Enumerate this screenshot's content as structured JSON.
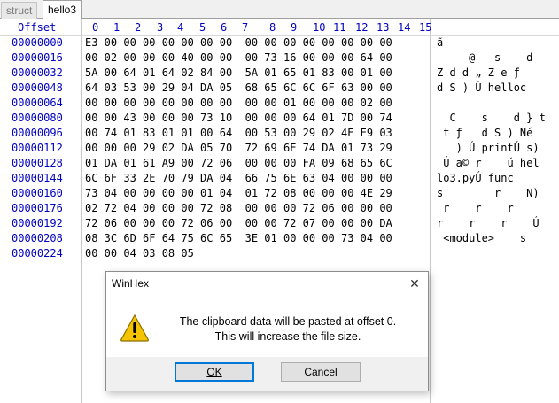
{
  "tabs": [
    {
      "label": "struct",
      "active": false
    },
    {
      "label": "hello3",
      "active": true
    }
  ],
  "header": {
    "offset_label": "Offset",
    "columns": [
      "0",
      "1",
      "2",
      "3",
      "4",
      "5",
      "6",
      "7",
      "8",
      "9",
      "10",
      "11",
      "12",
      "13",
      "14",
      "15"
    ]
  },
  "rows": [
    {
      "offset": "00000000",
      "hex": "E3 00 00 00 00 00 00 00  00 00 00 00 00 00 00 00",
      "text": "ã"
    },
    {
      "offset": "00000016",
      "hex": "00 02 00 00 00 40 00 00  00 73 16 00 00 00 64 00",
      "text": "     @   s    d"
    },
    {
      "offset": "00000032",
      "hex": "5A 00 64 01 64 02 84 00  5A 01 65 01 83 00 01 00",
      "text": "Z d d „ Z e ƒ"
    },
    {
      "offset": "00000048",
      "hex": "64 03 53 00 29 04 DA 05  68 65 6C 6C 6F 63 00 00",
      "text": "d S ) Ú helloc"
    },
    {
      "offset": "00000064",
      "hex": "00 00 00 00 00 00 00 00  00 00 01 00 00 00 02 00",
      "text": ""
    },
    {
      "offset": "00000080",
      "hex": "00 00 43 00 00 00 73 10  00 00 00 64 01 7D 00 74",
      "text": "  C    s    d } t"
    },
    {
      "offset": "00000096",
      "hex": "00 74 01 83 01 01 00 64  00 53 00 29 02 4E E9 03",
      "text": " t ƒ   d S ) Né"
    },
    {
      "offset": "00000112",
      "hex": "00 00 00 29 02 DA 05 70  72 69 6E 74 DA 01 73 29",
      "text": "   ) Ú printÚ s)"
    },
    {
      "offset": "00000128",
      "hex": "01 DA 01 61 A9 00 72 06  00 00 00 FA 09 68 65 6C",
      "text": " Ú a© r    ú hel"
    },
    {
      "offset": "00000144",
      "hex": "6C 6F 33 2E 70 79 DA 04  66 75 6E 63 04 00 00 00",
      "text": "lo3.pyÚ func"
    },
    {
      "offset": "00000160",
      "hex": "73 04 00 00 00 00 01 04  01 72 08 00 00 00 4E 29",
      "text": "s        r    N)"
    },
    {
      "offset": "00000176",
      "hex": "02 72 04 00 00 00 72 08  00 00 00 72 06 00 00 00",
      "text": " r    r    r"
    },
    {
      "offset": "00000192",
      "hex": "72 06 00 00 00 72 06 00  00 00 72 07 00 00 00 DA",
      "text": "r    r    r    Ú"
    },
    {
      "offset": "00000208",
      "hex": "08 3C 6D 6F 64 75 6C 65  3E 01 00 00 00 73 04 00",
      "text": " <module>    s"
    },
    {
      "offset": "00000224",
      "hex": "00 00 04 03 08 05",
      "text": ""
    }
  ],
  "dialog": {
    "title": "WinHex",
    "close_symbol": "✕",
    "message_line1": "The clipboard data will be pasted at offset 0.",
    "message_line2": "This will increase the file size.",
    "ok_label": "OK",
    "cancel_label": "Cancel",
    "icon": "warning-icon"
  },
  "colors": {
    "offset_blue": "#0000c0",
    "warning_yellow": "#f5c400"
  }
}
